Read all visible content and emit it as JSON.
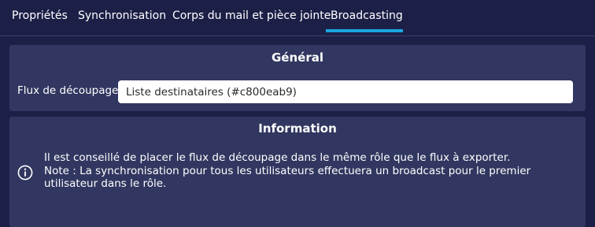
{
  "tabs": [
    {
      "label": "Propriétés"
    },
    {
      "label": "Synchronisation"
    },
    {
      "label": "Corps du mail et pièce jointe"
    },
    {
      "label": "Broadcasting",
      "active": true
    }
  ],
  "general": {
    "title": "Général",
    "field_label": "Flux de découpage",
    "field_value": "Liste destinataires (#c800eab9)"
  },
  "information": {
    "title": "Information",
    "icon": "info-circle-icon",
    "line1": "Il est conseillé de placer le flux de découpage dans le même rôle que le flux à exporter.",
    "line2": "Note : La synchronisation pour tous les utilisateurs effectuera un broadcast pour le premier utilisateur dans le rôle."
  },
  "colors": {
    "background": "#1c2047",
    "panel": "#313760",
    "accent": "#1aa6e0"
  }
}
